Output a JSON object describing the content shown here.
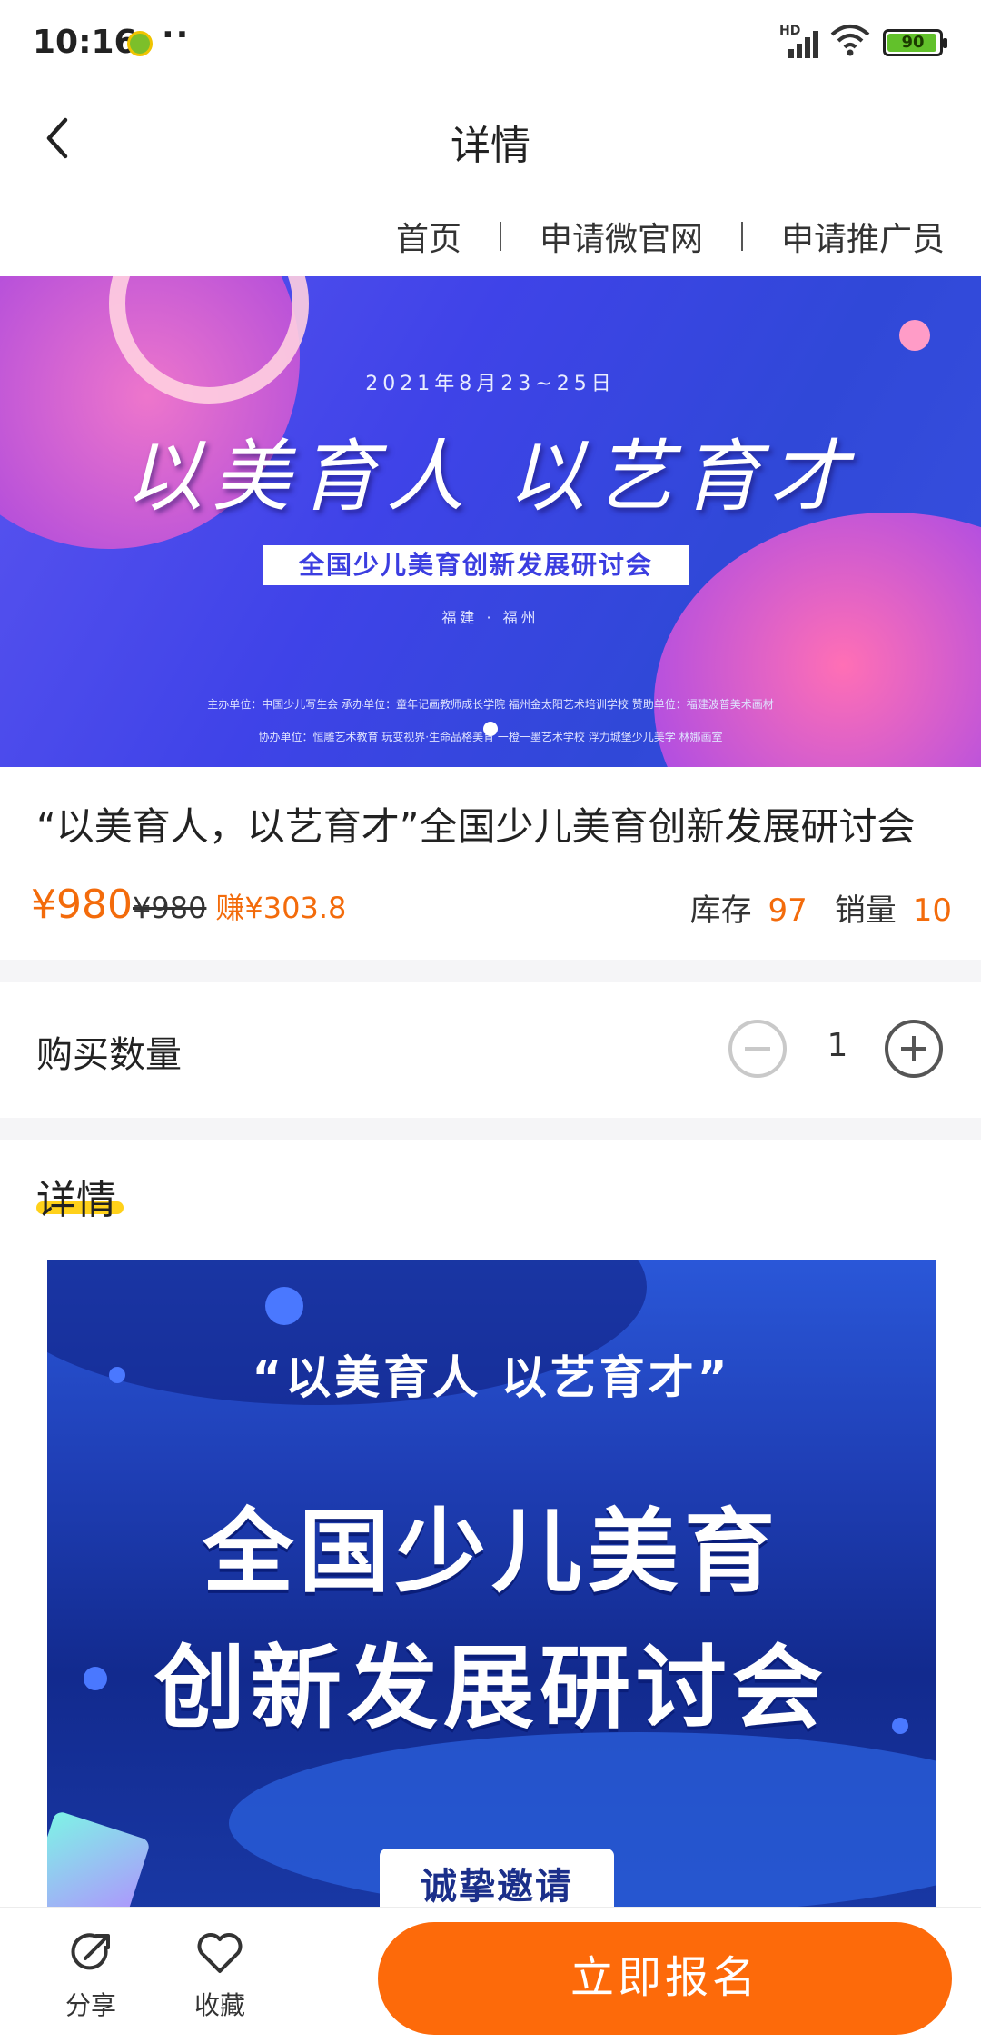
{
  "status_bar": {
    "time": "10:16",
    "dots": "··",
    "network_label": "HD",
    "battery": "90"
  },
  "nav": {
    "title": "详情",
    "back_icon": "chevron-left-icon"
  },
  "subnav": {
    "links": [
      "首页",
      "申请微官网",
      "申请推广员"
    ]
  },
  "banner": {
    "date": "2021年8月23~25日",
    "slogan": "以美育人 以艺育才",
    "subtitle": "全国少儿美育创新发展研讨会",
    "place": "福建 · 福州",
    "orgs_line1": "主办单位：中国少儿写生会     承办单位：童年记画教师成长学院     福州金太阳艺术培训学校     赞助单位：福建波普美术画材",
    "orgs_line2": "协办单位：恒雕艺术教育     玩变视界·生命品格美育     一橙一墨艺术学校     浮力城堡少儿美学     林娜画室"
  },
  "product": {
    "title": "“以美育人，以艺育才”全国少儿美育创新发展研讨会",
    "price": "¥980",
    "original_price": "¥980",
    "earn": "赚¥303.8",
    "stock_label": "库存",
    "stock_value": "97",
    "sales_label": "销量",
    "sales_value": "10"
  },
  "quantity": {
    "label": "购买数量",
    "value": "1"
  },
  "details": {
    "heading": "详情",
    "poster_quote": "“以美育人 以艺育才”",
    "poster_title_line1": "全国少儿美育",
    "poster_title_line2": "创新发展研讨会",
    "poster_invite": "诚挚邀请"
  },
  "bottom_bar": {
    "share_label": "分享",
    "favorite_label": "收藏",
    "signup_label": "立即报名"
  },
  "colors": {
    "accent": "#fd6a0a",
    "price": "#f36b0b",
    "highlight": "#ffd11a"
  }
}
